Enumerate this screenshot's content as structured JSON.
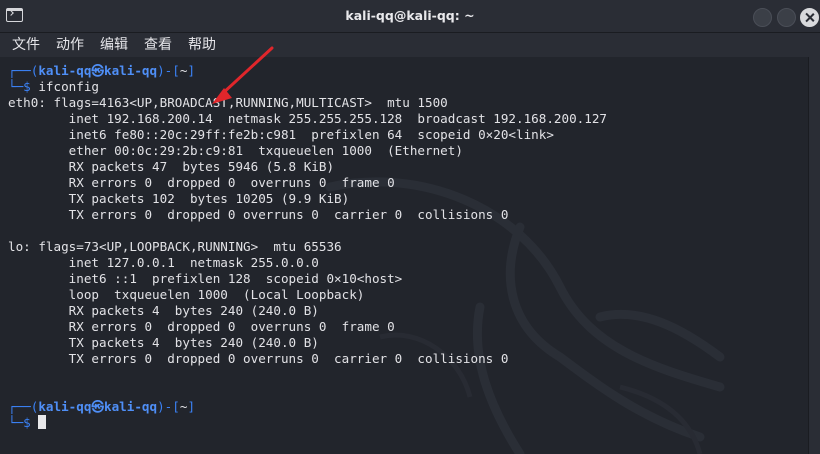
{
  "window": {
    "title": "kali-qq@kali-qq: ~"
  },
  "menu": [
    "文件",
    "动作",
    "编辑",
    "查看",
    "帮助"
  ],
  "prompt": {
    "user": "kali-qq",
    "at": "㉿",
    "host": "kali-qq",
    "cwd": "~"
  },
  "command": "ifconfig",
  "output": [
    "eth0: flags=4163<UP,BROADCAST,RUNNING,MULTICAST>  mtu 1500",
    "        inet 192.168.200.14  netmask 255.255.255.128  broadcast 192.168.200.127",
    "        inet6 fe80::20c:29ff:fe2b:c981  prefixlen 64  scopeid 0×20<link>",
    "        ether 00:0c:29:2b:c9:81  txqueuelen 1000  (Ethernet)",
    "        RX packets 47  bytes 5946 (5.8 KiB)",
    "        RX errors 0  dropped 0  overruns 0  frame 0",
    "        TX packets 102  bytes 10205 (9.9 KiB)",
    "        TX errors 0  dropped 0 overruns 0  carrier 0  collisions 0",
    "",
    "lo: flags=73<UP,LOOPBACK,RUNNING>  mtu 65536",
    "        inet 127.0.0.1  netmask 255.0.0.0",
    "        inet6 ::1  prefixlen 128  scopeid 0×10<host>",
    "        loop  txqueuelen 1000  (Local Loopback)",
    "        RX packets 4  bytes 240 (240.0 B)",
    "        RX errors 0  dropped 0  overruns 0  frame 0",
    "        TX packets 4  bytes 240 (240.0 B)",
    "        TX errors 0  dropped 0 overruns 0  carrier 0  collisions 0"
  ],
  "colors": {
    "background": "#22252c",
    "prompt_blue": "#3b82f6",
    "annotation_arrow": "#e0262b"
  },
  "icons": {
    "app": "terminal-icon",
    "minimize": "minimize-icon",
    "maximize": "maximize-icon",
    "close": "close-icon"
  }
}
